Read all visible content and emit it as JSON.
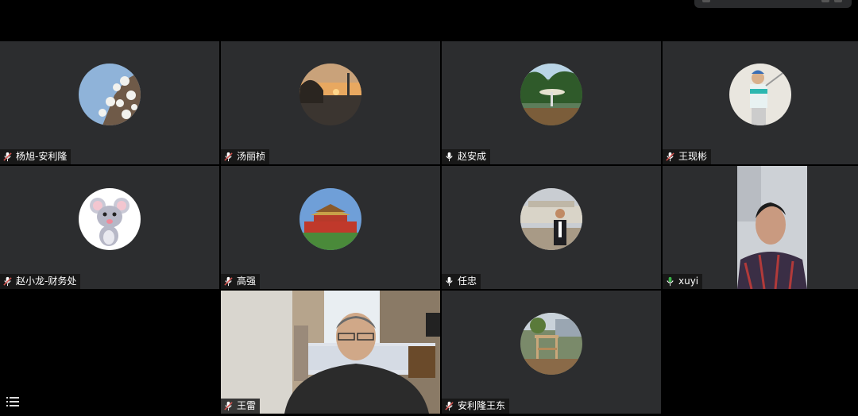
{
  "window": {
    "title": ""
  },
  "participants": [
    {
      "name": "杨旭-安利隆",
      "mic": "muted",
      "avatar": "magnolia-photo"
    },
    {
      "name": "汤丽桢",
      "mic": "muted",
      "avatar": "sunset-photo"
    },
    {
      "name": "赵安成",
      "mic": "on",
      "avatar": "garden-photo"
    },
    {
      "name": "王现彬",
      "mic": "muted",
      "avatar": "golfer-photo"
    },
    {
      "name": "赵小龙-财务处",
      "mic": "muted",
      "avatar": "cartoon-mouse"
    },
    {
      "name": "高强",
      "mic": "muted",
      "avatar": "tiananmen-photo"
    },
    {
      "name": "任忠",
      "mic": "on",
      "avatar": "man-street-photo"
    },
    {
      "name": "xuyi",
      "mic": "speaking",
      "avatar": "live-video",
      "active": true
    },
    {
      "name": "王雷",
      "mic": "muted",
      "avatar": "live-video"
    },
    {
      "name": "安利隆王东",
      "mic": "muted",
      "avatar": "chair-photo"
    }
  ],
  "colors": {
    "tile": "#2c2d2f",
    "speaking": "#3ab54a",
    "muted": "#d9534f"
  },
  "icons": {
    "participant_list": "list-icon"
  }
}
